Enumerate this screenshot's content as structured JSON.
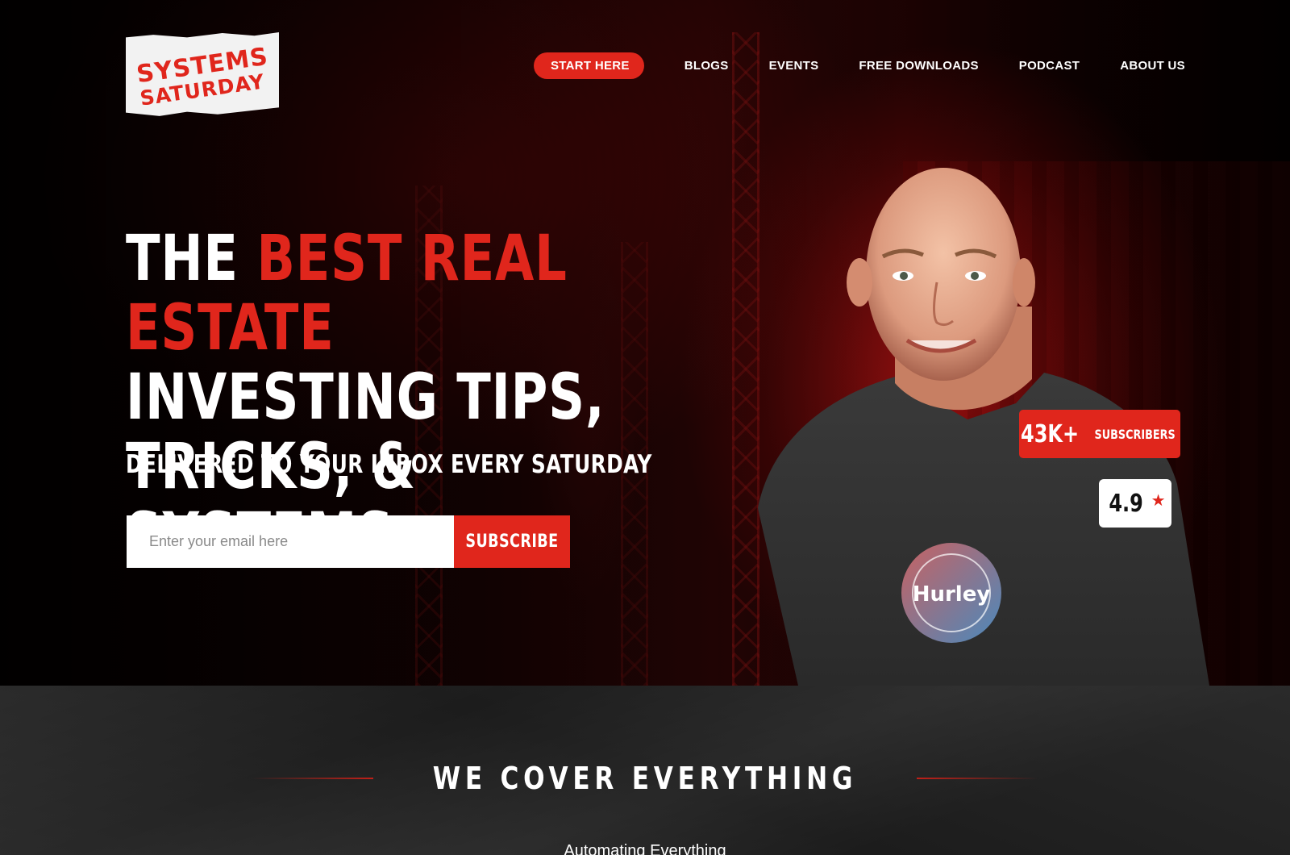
{
  "brand": {
    "logo_line1": "SYSTEMS",
    "logo_line2": "SATURDAY",
    "accent_color": "#e0261c"
  },
  "nav": {
    "items": [
      {
        "label": "START HERE",
        "active": true
      },
      {
        "label": "BLOGS"
      },
      {
        "label": "EVENTS"
      },
      {
        "label": "FREE DOWNLOADS"
      },
      {
        "label": "PODCAST"
      },
      {
        "label": "ABOUT US"
      }
    ]
  },
  "hero": {
    "headline_white1": "THE ",
    "headline_red": "BEST REAL ESTATE",
    "headline_line2": "INVESTING TIPS,",
    "headline_line3": "TRICKS, & SYSTEMS",
    "subheadline": "DELIVERED TO YOUR INBOX EVERY SATURDAY",
    "email_placeholder": "Enter your email here",
    "subscribe_label": "SUBSCRIBE",
    "subscribers_count": "43K+",
    "subscribers_label": "SUBSCRIBERS",
    "rating_value": "4.9",
    "rating_icon": "star-icon",
    "shirt_logo": "Hurley"
  },
  "section": {
    "title": "WE COVER EVERYTHING",
    "subtitle": "Automating Everything"
  }
}
